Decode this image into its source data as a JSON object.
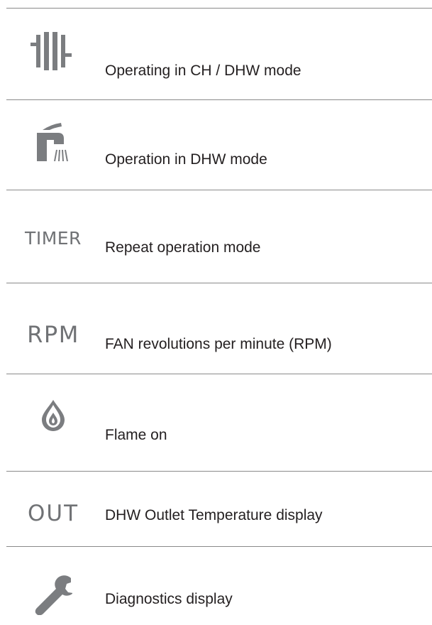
{
  "legend": {
    "rows": [
      {
        "icon": "radiator-icon",
        "label": "Operating in CH / DHW mode"
      },
      {
        "icon": "tap-icon",
        "label": "Operation in DHW mode"
      },
      {
        "icon_text": "TIMER",
        "label": "Repeat operation mode"
      },
      {
        "icon_text": "RPM",
        "label": "FAN revolutions per minute (RPM)"
      },
      {
        "icon": "flame-icon",
        "label": "Flame on"
      },
      {
        "icon_text": "OUT",
        "label": "DHW Outlet Temperature display"
      },
      {
        "icon": "wrench-icon",
        "label": "Diagnostics display"
      }
    ]
  },
  "colors": {
    "icon": "#7b7d80",
    "rule": "#8a8a8a",
    "text": "#231f20"
  }
}
